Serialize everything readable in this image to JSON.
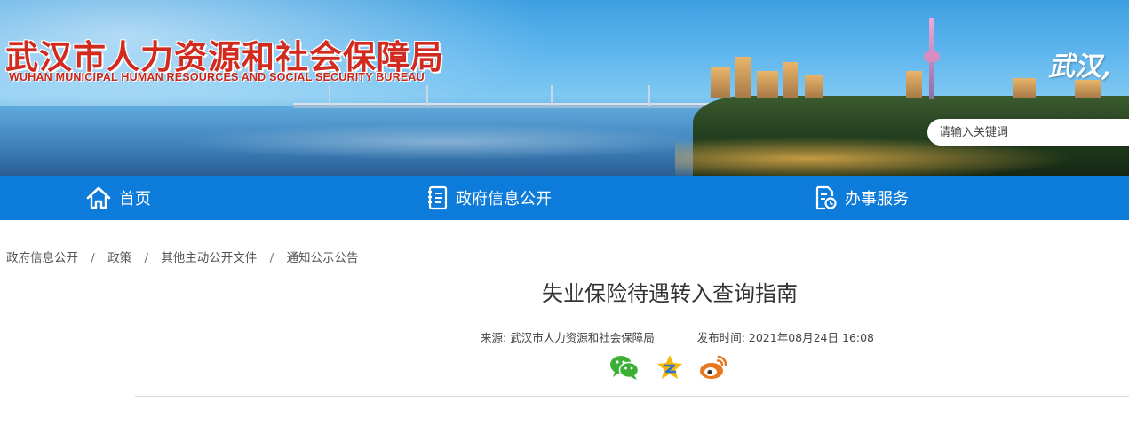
{
  "header": {
    "title": "武汉市人力资源和社会保障局",
    "subtitle": "WUHAN MUNICIPAL HUMAN RESOURCES AND SOCIAL SECURITY BUREAU",
    "slogan": "武汉,"
  },
  "search": {
    "placeholder": "请输入关键词",
    "value": ""
  },
  "nav": {
    "items": [
      {
        "label": "首页",
        "icon": "home-icon"
      },
      {
        "label": "政府信息公开",
        "icon": "document-icon"
      },
      {
        "label": "办事服务",
        "icon": "service-icon"
      }
    ]
  },
  "breadcrumb": {
    "items": [
      "政府信息公开",
      "政策",
      "其他主动公开文件",
      "通知公示公告"
    ],
    "separator": "/"
  },
  "article": {
    "title": "失业保险待遇转入查询指南",
    "source_label": "来源:",
    "source": "武汉市人力资源和社会保障局",
    "published_label": "发布时间:",
    "published": "2021年08月24日 16:08"
  },
  "share": {
    "icons": [
      "wechat-icon",
      "qzone-icon",
      "weibo-icon"
    ],
    "colors": {
      "wechat": "#3cb034",
      "qzone": "#f5b800",
      "weibo": "#e8771d"
    }
  },
  "colors": {
    "nav_bg": "#0c7bd9",
    "title_red": "#d12a1e"
  }
}
